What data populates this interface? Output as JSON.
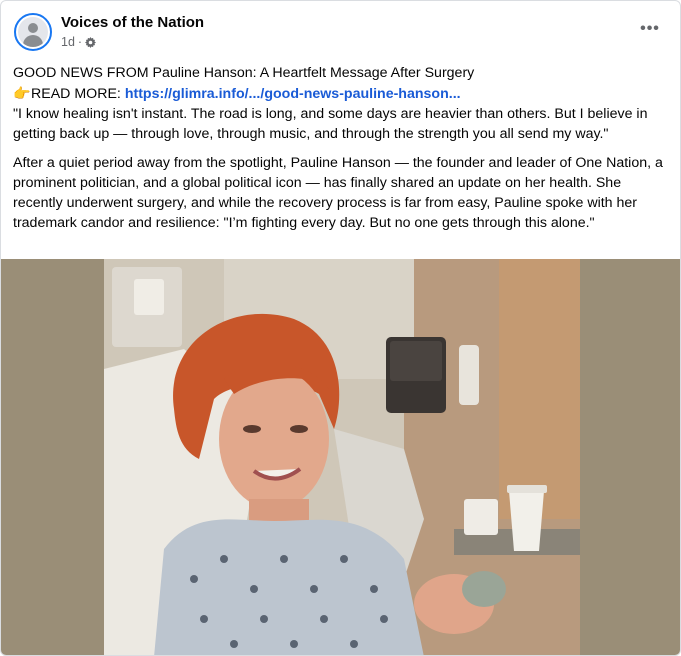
{
  "post": {
    "page_name": "Voices of the Nation",
    "time": "1d",
    "separator": "·",
    "audience_icon": "gear-icon",
    "more_icon": "more-dots-icon",
    "more_glyph": "•••",
    "headline": "GOOD NEWS FROM Pauline Hanson: A Heartfelt Message After Surgery",
    "pointing_icon": "pointing-hand-icon",
    "pointing_emoji": "👉",
    "read_more_label": "READ MORE: ",
    "link_text": "https://glimra.info/.../good-news-pauline-hanson...",
    "quote": "\"I know healing isn't instant. The road is long, and some days are heavier than others. But I believe in getting back up — through love, through music, and through the strength you all send my way.\"",
    "body": "After a quiet period away from the spotlight, Pauline Hanson — the founder and leader of One Nation, a prominent politician, and a global political icon — has finally shared an update on her health. She recently underwent surgery, and while the recovery process is far from easy, Pauline spoke with her trademark candor and resilience: \"I’m fighting every day. But no one gets through this alone.\""
  },
  "colors": {
    "link": "#1a5bd6",
    "avatar_ring": "#1877f2",
    "meta_text": "#65676b",
    "photo_backdrop": "#9a8e77"
  }
}
